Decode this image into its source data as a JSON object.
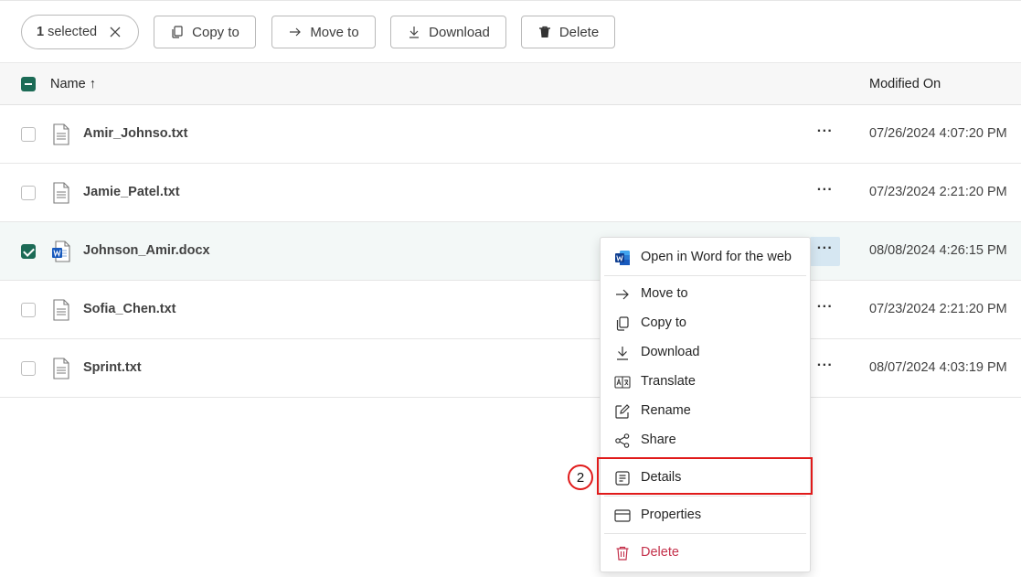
{
  "toolbar": {
    "selected_count": "1",
    "selected_label": "selected",
    "copy_label": "Copy to",
    "move_label": "Move to",
    "download_label": "Download",
    "delete_label": "Delete"
  },
  "table": {
    "col_name": "Name",
    "sort_indicator": "↑",
    "col_modified": "Modified On",
    "rows": [
      {
        "name": "Amir_Johnso.txt",
        "modified": "07/26/2024 4:07:20 PM",
        "type": "txt",
        "selected": false
      },
      {
        "name": "Jamie_Patel.txt",
        "modified": "07/23/2024 2:21:20 PM",
        "type": "txt",
        "selected": false
      },
      {
        "name": "Johnson_Amir.docx",
        "modified": "08/08/2024 4:26:15 PM",
        "type": "docx",
        "selected": true
      },
      {
        "name": "Sofia_Chen.txt",
        "modified": "07/23/2024 2:21:20 PM",
        "type": "txt",
        "selected": false
      },
      {
        "name": "Sprint.txt",
        "modified": "08/07/2024 4:03:19 PM",
        "type": "txt",
        "selected": false
      }
    ],
    "more_glyph": "···"
  },
  "context_menu": {
    "items": [
      {
        "label": "Open in Word for the web",
        "icon": "word-icon"
      },
      {
        "label": "Move to",
        "icon": "arrow-right-icon"
      },
      {
        "label": "Copy to",
        "icon": "copy-icon"
      },
      {
        "label": "Download",
        "icon": "download-icon"
      },
      {
        "label": "Translate",
        "icon": "translate-icon"
      },
      {
        "label": "Rename",
        "icon": "rename-icon"
      },
      {
        "label": "Share",
        "icon": "share-icon"
      },
      {
        "label": "Details",
        "icon": "details-icon"
      },
      {
        "label": "Properties",
        "icon": "properties-icon"
      },
      {
        "label": "Delete",
        "icon": "trash-icon"
      }
    ]
  },
  "annotation": {
    "step_number": "2"
  },
  "colors": {
    "accent": "#1c6b56",
    "highlight": "#e01a1a",
    "danger": "#c4314b",
    "word_blue": "#185abd"
  }
}
